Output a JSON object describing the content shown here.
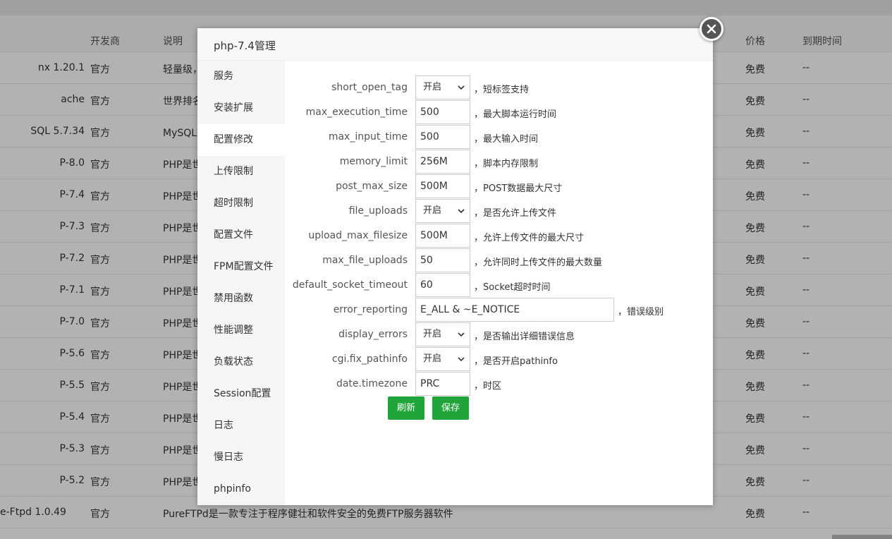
{
  "background": {
    "headers": {
      "name": "",
      "developer": "开发商",
      "description": "说明",
      "price": "价格",
      "expire": "到期时间"
    },
    "rows": [
      {
        "name": "nx 1.20.1",
        "developer": "官方",
        "description": "轻量级，",
        "price": "免费",
        "expire": "--"
      },
      {
        "name": "ache",
        "developer": "官方",
        "description": "世界排名",
        "price": "免费",
        "expire": "--"
      },
      {
        "name": "SQL 5.7.34",
        "developer": "官方",
        "description": "MySQL是",
        "price": "免费",
        "expire": "--"
      },
      {
        "name": "P-8.0",
        "developer": "官方",
        "description": "PHP是世",
        "price": "免费",
        "expire": "--"
      },
      {
        "name": "P-7.4",
        "developer": "官方",
        "description": "PHP是世",
        "price": "免费",
        "expire": "--"
      },
      {
        "name": "P-7.3",
        "developer": "官方",
        "description": "PHP是世",
        "price": "免费",
        "expire": "--"
      },
      {
        "name": "P-7.2",
        "developer": "官方",
        "description": "PHP是世",
        "price": "免费",
        "expire": "--"
      },
      {
        "name": "P-7.1",
        "developer": "官方",
        "description": "PHP是世",
        "price": "免费",
        "expire": "--"
      },
      {
        "name": "P-7.0",
        "developer": "官方",
        "description": "PHP是世",
        "price": "免费",
        "expire": "--"
      },
      {
        "name": "P-5.6",
        "developer": "官方",
        "description": "PHP是世",
        "price": "免费",
        "expire": "--"
      },
      {
        "name": "P-5.5",
        "developer": "官方",
        "description": "PHP是世",
        "price": "免费",
        "expire": "--"
      },
      {
        "name": "P-5.4",
        "developer": "官方",
        "description": "PHP是世",
        "price": "免费",
        "expire": "--"
      },
      {
        "name": "P-5.3",
        "developer": "官方",
        "description": "PHP是世",
        "price": "免费",
        "expire": "--"
      },
      {
        "name": "P-5.2",
        "developer": "官方",
        "description": "PHP是世",
        "price": "免费",
        "expire": "--"
      },
      {
        "name": "e-Ftpd 1.0.49",
        "developer": "官方",
        "description": "PureFTPd是一款专注于程序健壮和软件安全的免费FTP服务器软件",
        "price": "免费",
        "expire": "--"
      }
    ]
  },
  "modal": {
    "title": "php-7.4管理",
    "close_icon": "close-icon",
    "sidebar": [
      "服务",
      "安装扩展",
      "配置修改",
      "上传限制",
      "超时限制",
      "配置文件",
      "FPM配置文件",
      "禁用函数",
      "性能调整",
      "负载状态",
      "Session配置",
      "日志",
      "慢日志",
      "phpinfo"
    ],
    "active_sidebar": "配置修改",
    "settings": [
      {
        "label": "short_open_tag",
        "type": "select",
        "value": "开启",
        "desc": "，短标签支持"
      },
      {
        "label": "max_execution_time",
        "type": "input",
        "value": "500",
        "desc": "，最大脚本运行时间"
      },
      {
        "label": "max_input_time",
        "type": "input",
        "value": "500",
        "desc": "，最大输入时间"
      },
      {
        "label": "memory_limit",
        "type": "input",
        "value": "256M",
        "desc": "，脚本内存限制"
      },
      {
        "label": "post_max_size",
        "type": "input",
        "value": "500M",
        "desc": "，POST数据最大尺寸"
      },
      {
        "label": "file_uploads",
        "type": "select",
        "value": "开启",
        "desc": "，是否允许上传文件"
      },
      {
        "label": "upload_max_filesize",
        "type": "input",
        "value": "500M",
        "desc": "，允许上传文件的最大尺寸"
      },
      {
        "label": "max_file_uploads",
        "type": "input",
        "value": "50",
        "desc": "，允许同时上传文件的最大数量"
      },
      {
        "label": "default_socket_timeout",
        "type": "input",
        "value": "60",
        "desc": "，Socket超时时间"
      },
      {
        "label": "error_reporting",
        "type": "input-wide",
        "value": "E_ALL & ~E_NOTICE",
        "desc": "，错误级别"
      },
      {
        "label": "display_errors",
        "type": "select",
        "value": "开启",
        "desc": "，是否输出详细错误信息"
      },
      {
        "label": "cgi.fix_pathinfo",
        "type": "select",
        "value": "开启",
        "desc": "，是否开启pathinfo"
      },
      {
        "label": "date.timezone",
        "type": "input",
        "value": "PRC",
        "desc": "，时区"
      }
    ],
    "buttons": {
      "refresh": "刷新",
      "save": "保存"
    },
    "colors": {
      "accent": "#20a53a"
    }
  }
}
